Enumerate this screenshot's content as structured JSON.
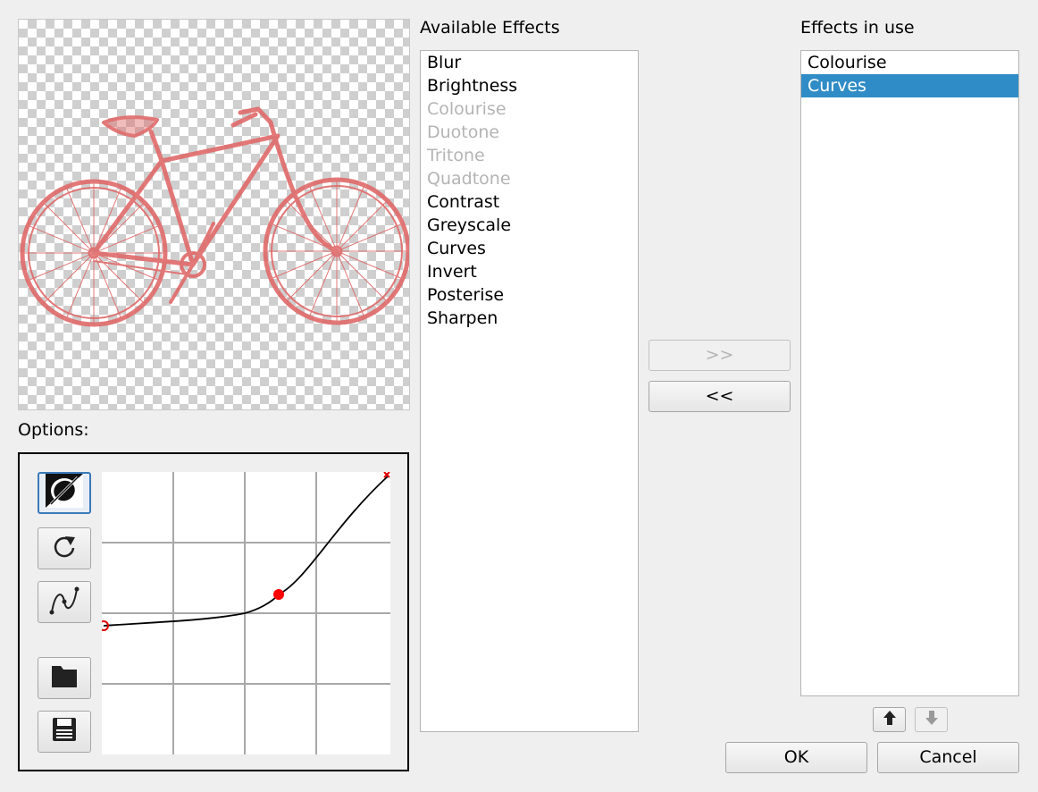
{
  "preview": {
    "image": "bicycle-illustration"
  },
  "options": {
    "label": "Options:",
    "tools": [
      {
        "name": "invert-curve-icon"
      },
      {
        "name": "reset-icon"
      },
      {
        "name": "smooth-curve-icon"
      },
      {
        "name": "open-folder-icon"
      },
      {
        "name": "save-icon"
      }
    ]
  },
  "available": {
    "label": "Available Effects",
    "items": [
      {
        "label": "Blur",
        "enabled": true
      },
      {
        "label": "Brightness",
        "enabled": true
      },
      {
        "label": "Colourise",
        "enabled": false
      },
      {
        "label": "Duotone",
        "enabled": false
      },
      {
        "label": "Tritone",
        "enabled": false
      },
      {
        "label": "Quadtone",
        "enabled": false
      },
      {
        "label": "Contrast",
        "enabled": true
      },
      {
        "label": "Greyscale",
        "enabled": true
      },
      {
        "label": "Curves",
        "enabled": true
      },
      {
        "label": "Invert",
        "enabled": true
      },
      {
        "label": "Posterise",
        "enabled": true
      },
      {
        "label": "Sharpen",
        "enabled": true
      }
    ]
  },
  "transfer": {
    "add_label": ">>",
    "remove_label": "<<"
  },
  "in_use": {
    "label": "Effects in use",
    "items": [
      {
        "label": "Colourise",
        "selected": false
      },
      {
        "label": "Curves",
        "selected": true
      }
    ]
  },
  "order": {
    "up_icon": "arrow-up-icon",
    "down_icon": "arrow-down-icon"
  },
  "dialog": {
    "ok_label": "OK",
    "cancel_label": "Cancel"
  },
  "colors": {
    "selection": "#308cc6",
    "curve_point": "#ff0000",
    "tint": "#e06a6a"
  }
}
